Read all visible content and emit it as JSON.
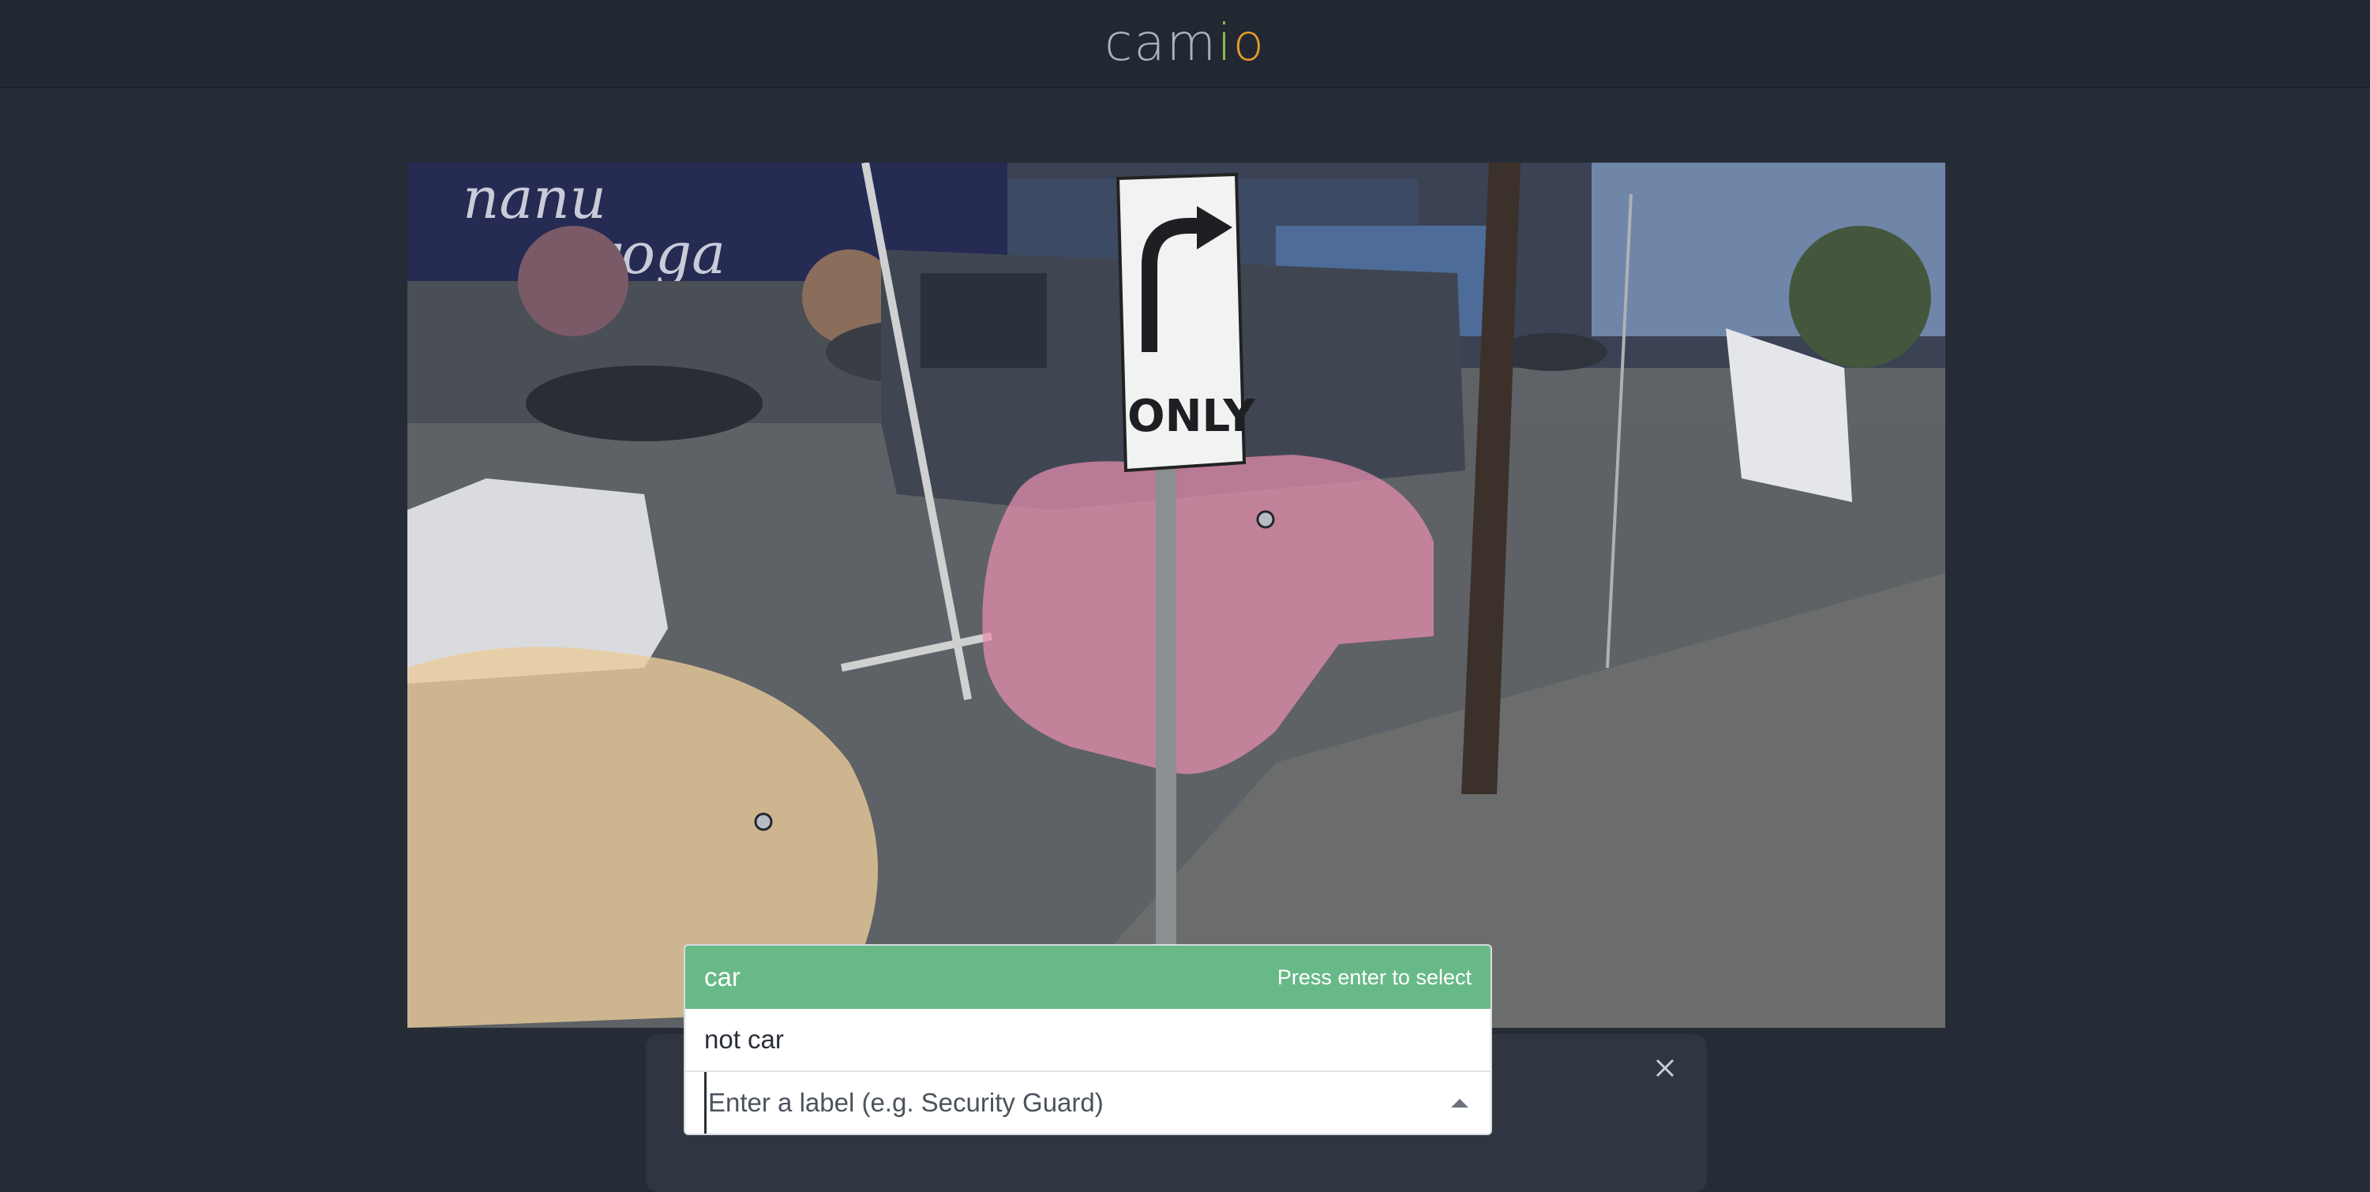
{
  "header": {
    "logo_letters": [
      "cam",
      "i",
      "o"
    ],
    "logo_colors": {
      "base": "#a9b1bd",
      "i": "#8fc04a",
      "o": "#e39a2d"
    }
  },
  "scene": {
    "highlight_colors": {
      "pink": "#e78fae",
      "tan": "#e8cc9a"
    },
    "sign_text": "ONLY",
    "mural_text": [
      "nanu",
      "yoga"
    ]
  },
  "label_picker": {
    "options": [
      {
        "label": "car",
        "hint": "Press enter to select",
        "selected": true
      },
      {
        "label": "not car",
        "hint": "",
        "selected": false
      }
    ],
    "input": {
      "value": "",
      "placeholder": "Enter a label (e.g. Security Guard)"
    },
    "accent": "#68b988"
  },
  "panel": {
    "close_icon": "close-icon"
  }
}
